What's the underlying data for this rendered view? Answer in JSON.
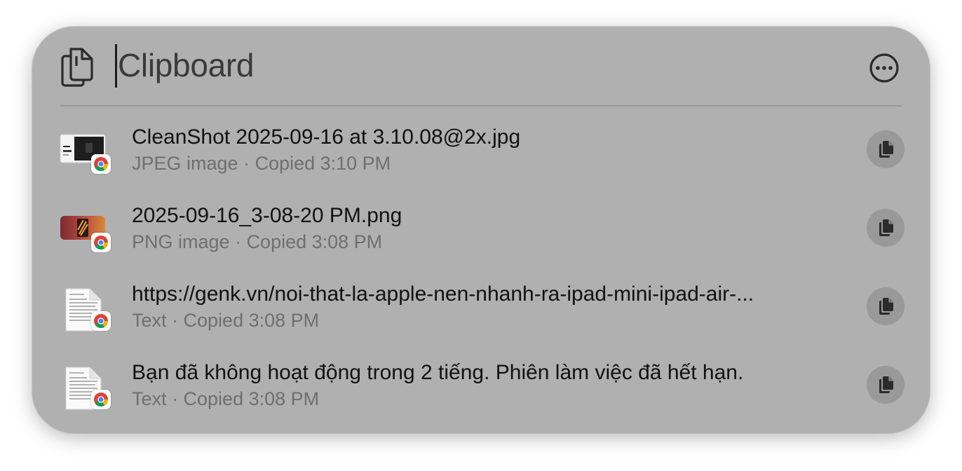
{
  "header": {
    "title": "Clipboard",
    "app_icon": "documents-icon",
    "more_icon": "ellipsis-circle-icon"
  },
  "items": [
    {
      "title": "CleanShot 2025-09-16 at 3.10.08@2x.jpg",
      "kind": "JPEG image",
      "copied": "Copied 3:10 PM",
      "thumb": "screenshot-thumbnail",
      "source": "chrome-icon"
    },
    {
      "title": "2025-09-16_3-08-20 PM.png",
      "kind": "PNG image",
      "copied": "Copied 3:08 PM",
      "thumb": "image-thumbnail",
      "source": "chrome-icon"
    },
    {
      "title": "https://genk.vn/noi-that-la-apple-nen-nhanh-ra-ipad-mini-ipad-air-...",
      "kind": "Text",
      "copied": "Copied 3:08 PM",
      "thumb": "text-document-icon",
      "source": "chrome-icon"
    },
    {
      "title": "Bạn đã không hoạt động trong 2 tiếng. Phiên làm việc đã hết hạn.",
      "kind": "Text",
      "copied": "Copied 3:08 PM",
      "thumb": "text-document-icon",
      "source": "chrome-icon"
    }
  ],
  "separator": " · ",
  "colors": {
    "panel": "#b0b0b0",
    "title_text": "#111111",
    "subtitle_text": "#6f6f6f",
    "copy_button": "#999999"
  }
}
